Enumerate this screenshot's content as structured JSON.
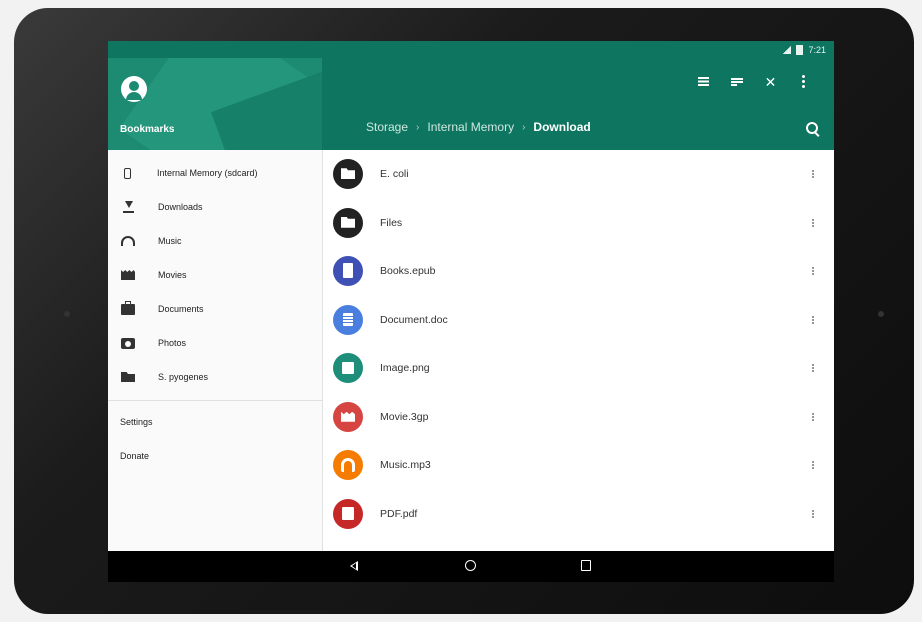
{
  "status_bar": {
    "time": "7:21"
  },
  "drawer": {
    "title": "Bookmarks",
    "items": [
      {
        "label": "Internal Memory (sdcard)",
        "icon": "phone-icon"
      },
      {
        "label": "Downloads",
        "icon": "download-icon"
      },
      {
        "label": "Music",
        "icon": "headphones-icon"
      },
      {
        "label": "Movies",
        "icon": "movie-icon"
      },
      {
        "label": "Documents",
        "icon": "briefcase-icon"
      },
      {
        "label": "Photos",
        "icon": "camera-icon"
      },
      {
        "label": "S. pyogenes",
        "icon": "folder-icon"
      }
    ],
    "secondary": [
      {
        "label": "Settings"
      },
      {
        "label": "Donate"
      }
    ]
  },
  "app_bar": {
    "breadcrumb": [
      "Storage",
      "Internal Memory",
      "Download"
    ],
    "separator": "›",
    "actions": [
      "list-view-icon",
      "sort-icon",
      "close-icon",
      "more-vert-icon"
    ],
    "close_glyph": "✕"
  },
  "files": [
    {
      "name": "E. coli",
      "icon": "folder-icon",
      "color": "#222222"
    },
    {
      "name": "Files",
      "icon": "folder-icon",
      "color": "#222222"
    },
    {
      "name": "Books.epub",
      "icon": "book-icon",
      "color": "#3f51b5"
    },
    {
      "name": "Document.doc",
      "icon": "document-icon",
      "color": "#4a7fe0"
    },
    {
      "name": "Image.png",
      "icon": "image-icon",
      "color": "#1e8e7a"
    },
    {
      "name": "Movie.3gp",
      "icon": "movie-icon",
      "color": "#d64541"
    },
    {
      "name": "Music.mp3",
      "icon": "headphones-icon",
      "color": "#f57c00"
    },
    {
      "name": "PDF.pdf",
      "icon": "pdf-icon",
      "color": "#c62828"
    }
  ],
  "colors": {
    "primary": "#0e7560",
    "drawer_header": "#1d8a72"
  }
}
